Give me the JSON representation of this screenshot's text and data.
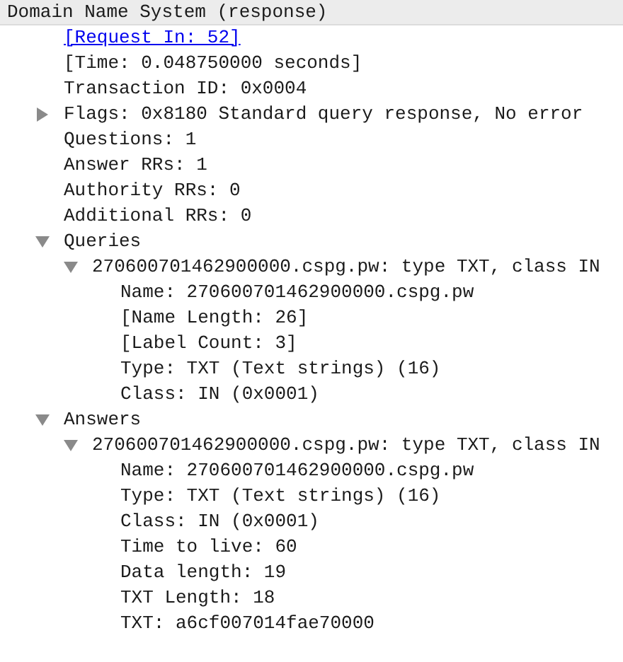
{
  "tree": {
    "label": "Domain Name System (response)",
    "children": [
      {
        "label": "[Request In: 52]",
        "kind": "link"
      },
      {
        "label": "[Time: 0.048750000 seconds]"
      },
      {
        "label": "Transaction ID: 0x0004"
      },
      {
        "label": "Flags: 0x8180 Standard query response, No error",
        "expanded": false
      },
      {
        "label": "Questions: 1"
      },
      {
        "label": "Answer RRs: 1"
      },
      {
        "label": "Authority RRs: 0"
      },
      {
        "label": "Additional RRs: 0"
      },
      {
        "label": "Queries",
        "expanded": true,
        "children": [
          {
            "label": "270600701462900000.cspg.pw: type TXT, class IN",
            "expanded": true,
            "children": [
              {
                "label": "Name: 270600701462900000.cspg.pw"
              },
              {
                "label": "[Name Length: 26]"
              },
              {
                "label": "[Label Count: 3]"
              },
              {
                "label": "Type: TXT (Text strings) (16)"
              },
              {
                "label": "Class: IN (0x0001)"
              }
            ]
          }
        ]
      },
      {
        "label": "Answers",
        "expanded": true,
        "children": [
          {
            "label": "270600701462900000.cspg.pw: type TXT, class IN",
            "expanded": true,
            "children": [
              {
                "label": "Name: 270600701462900000.cspg.pw"
              },
              {
                "label": "Type: TXT (Text strings) (16)"
              },
              {
                "label": "Class: IN (0x0001)"
              },
              {
                "label": "Time to live: 60"
              },
              {
                "label": "Data length: 19"
              },
              {
                "label": "TXT Length: 18"
              },
              {
                "label": "TXT: a6cf007014fae70000"
              }
            ]
          }
        ]
      }
    ]
  }
}
